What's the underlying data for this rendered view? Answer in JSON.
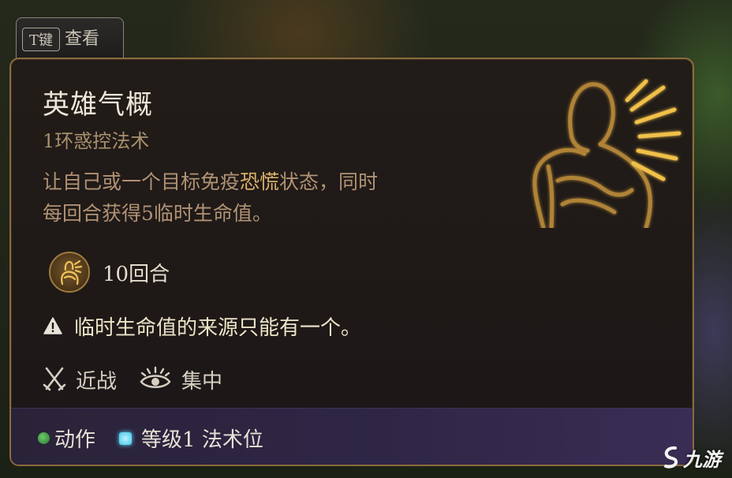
{
  "hint": {
    "key": "T键",
    "label": "查看"
  },
  "spell": {
    "title": "英雄气概",
    "subtitle": "1环惑控法术",
    "description_lines": [
      {
        "before": "让自己或一个目标免疫",
        "highlight": "恐慌",
        "after": "状态，同时"
      },
      {
        "before": "每回合获得5临时生命值。",
        "highlight": "",
        "after": ""
      }
    ],
    "duration": "10回合",
    "warning": "临时生命值的来源只能有一个。",
    "tags": [
      {
        "icon": "crossed-swords-icon",
        "label": "近战"
      },
      {
        "icon": "concentration-eye-icon",
        "label": "集中"
      }
    ],
    "costs": [
      {
        "icon": "action-dot-icon",
        "label": "动作",
        "color": "#3fa045"
      },
      {
        "icon": "spell-slot-square-icon",
        "label": "等级1 法术位",
        "color": "#54d8ff"
      }
    ]
  },
  "watermark": {
    "text": "九游"
  },
  "colors": {
    "panel_border": "#8a6a3e",
    "emblem_gold": "#d9a64a",
    "highlight": "#ddb26a"
  }
}
